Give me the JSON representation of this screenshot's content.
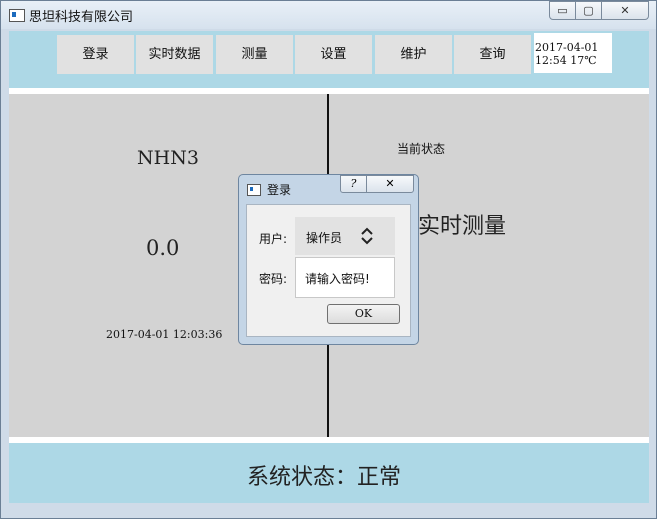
{
  "window": {
    "title": "思坦科技有限公司",
    "controls": {
      "minimize": "▭",
      "maximize": "▢",
      "close": "✕"
    }
  },
  "nav": {
    "items": [
      {
        "label": "登录"
      },
      {
        "label": "实时数据"
      },
      {
        "label": "测量"
      },
      {
        "label": "设置"
      },
      {
        "label": "维护"
      },
      {
        "label": "查询"
      }
    ]
  },
  "clock": {
    "date": "2017-04-01",
    "time_temp": "12:54 17℃"
  },
  "measurement": {
    "gas_name": "NHN3",
    "value": "0.0",
    "timestamp": "2017-04-01 12:03:36"
  },
  "state": {
    "label": "当前状态",
    "value": "实时测量"
  },
  "status_bar": {
    "text": "系统状态：正常"
  },
  "login_dialog": {
    "title": "登录",
    "help": "?",
    "close": "✕",
    "user_label": "用户:",
    "user_value": "操作员",
    "password_label": "密码:",
    "password_value": "请输入密码!",
    "ok_label": "OK"
  },
  "colors": {
    "panel_blue": "#add8e6",
    "main_gray": "#d3d3d3",
    "button_gray": "#e1e1e1"
  }
}
